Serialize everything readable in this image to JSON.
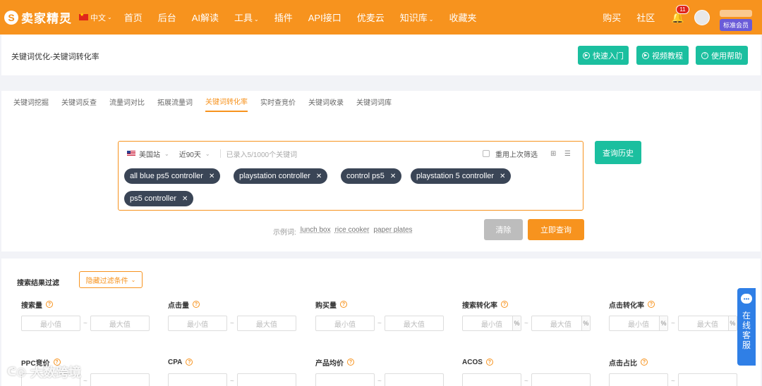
{
  "nav": {
    "logo": "卖家精灵",
    "lang": "中文",
    "items": [
      "首页",
      "后台",
      "AI解读",
      "工具",
      "插件",
      "API接口",
      "优麦云",
      "知识库",
      "收藏夹"
    ],
    "right_items": [
      "购买",
      "社区"
    ],
    "notification_count": "11",
    "member_badge": "标准会员"
  },
  "header": {
    "title": "关键词优化-关键词转化率",
    "buttons": [
      "快速入门",
      "视频教程",
      "使用帮助"
    ]
  },
  "tabs": [
    "关键词挖掘",
    "关键词反查",
    "流量词对比",
    "拓展流量词",
    "关键词转化率",
    "实时查竞价",
    "关键词收录",
    "关键词词库"
  ],
  "active_tab": 4,
  "search": {
    "site": "美国站",
    "period": "近90天",
    "hint": "已录入5/1000个关键词",
    "reuse_label": "重用上次筛选",
    "tags": [
      "all blue ps5 controller",
      "playstation controller",
      "control ps5",
      "playstation 5 controller",
      "ps5 controller"
    ],
    "examples_label": "示例词:",
    "examples": [
      "lunch box",
      "rice cooker",
      "paper plates"
    ],
    "clear_label": "清除",
    "query_label": "立即查询",
    "history_label": "查询历史"
  },
  "filters": {
    "title": "搜索结果过滤",
    "toggle_label": "隐藏过滤条件",
    "min_placeholder": "最小值",
    "max_placeholder": "最大值",
    "range_sep": "~",
    "pct": "%",
    "row1": [
      "搜索量",
      "点击量",
      "购买量",
      "搜索转化率",
      "点击转化率"
    ],
    "row2": [
      "PPC竞价",
      "CPA",
      "产品均价",
      "ACOS",
      "点击占比"
    ]
  },
  "service": {
    "text": "在线客服"
  },
  "watermark": "大数跨境"
}
